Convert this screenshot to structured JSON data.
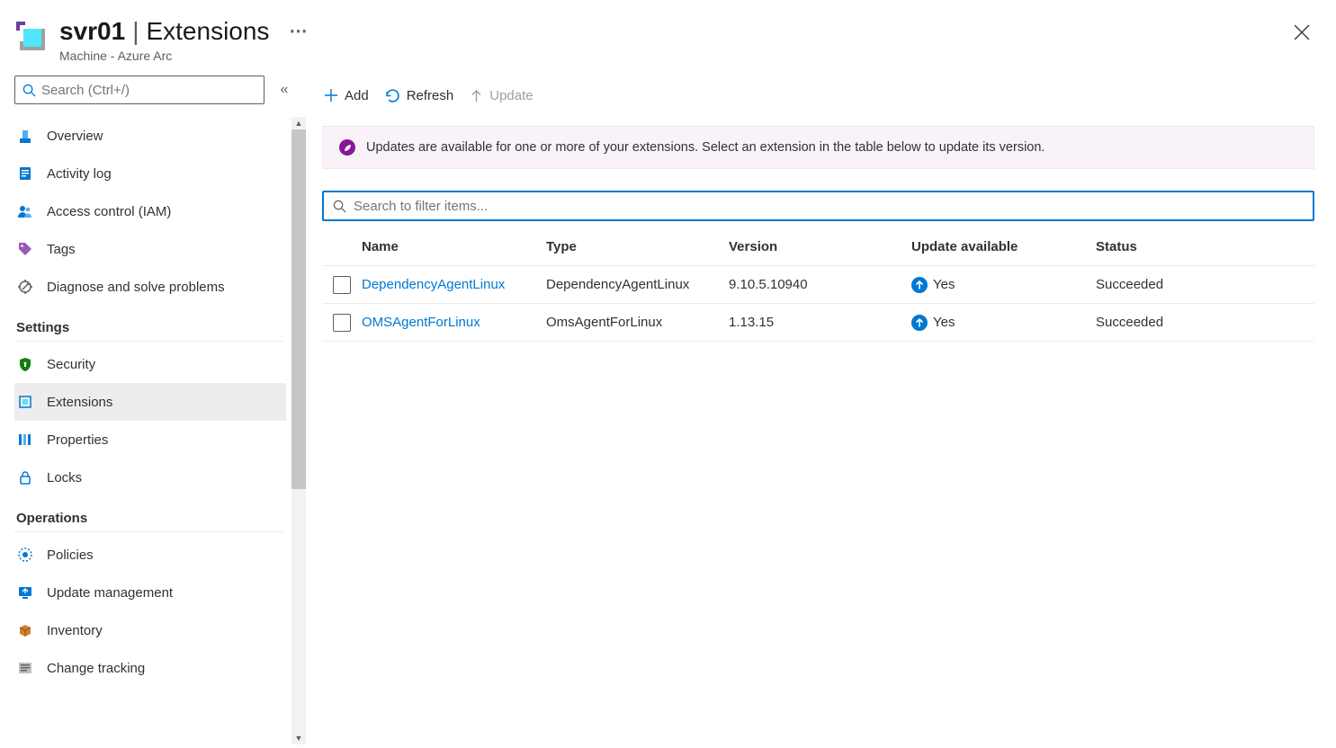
{
  "header": {
    "resource_name": "svr01",
    "page_name": "Extensions",
    "subtitle": "Machine - Azure Arc"
  },
  "sidebar": {
    "search_placeholder": "Search (Ctrl+/)",
    "items_top": [
      {
        "label": "Overview",
        "icon": "overview"
      },
      {
        "label": "Activity log",
        "icon": "activity"
      },
      {
        "label": "Access control (IAM)",
        "icon": "iam"
      },
      {
        "label": "Tags",
        "icon": "tags"
      },
      {
        "label": "Diagnose and solve problems",
        "icon": "diagnose"
      }
    ],
    "section_settings": "Settings",
    "items_settings": [
      {
        "label": "Security",
        "icon": "security"
      },
      {
        "label": "Extensions",
        "icon": "extensions",
        "active": true
      },
      {
        "label": "Properties",
        "icon": "properties"
      },
      {
        "label": "Locks",
        "icon": "locks"
      }
    ],
    "section_operations": "Operations",
    "items_operations": [
      {
        "label": "Policies",
        "icon": "policies"
      },
      {
        "label": "Update management",
        "icon": "update"
      },
      {
        "label": "Inventory",
        "icon": "inventory"
      },
      {
        "label": "Change tracking",
        "icon": "change"
      }
    ]
  },
  "toolbar": {
    "add": "Add",
    "refresh": "Refresh",
    "update": "Update"
  },
  "banner": {
    "text": "Updates are available for one or more of your extensions. Select an extension in the table below to update its version."
  },
  "filter": {
    "placeholder": "Search to filter items..."
  },
  "table": {
    "headers": {
      "name": "Name",
      "type": "Type",
      "version": "Version",
      "update": "Update available",
      "status": "Status"
    },
    "rows": [
      {
        "name": "DependencyAgentLinux",
        "type": "DependencyAgentLinux",
        "version": "9.10.5.10940",
        "update": "Yes",
        "status": "Succeeded"
      },
      {
        "name": "OMSAgentForLinux",
        "type": "OmsAgentForLinux",
        "version": "1.13.15",
        "update": "Yes",
        "status": "Succeeded"
      }
    ]
  }
}
